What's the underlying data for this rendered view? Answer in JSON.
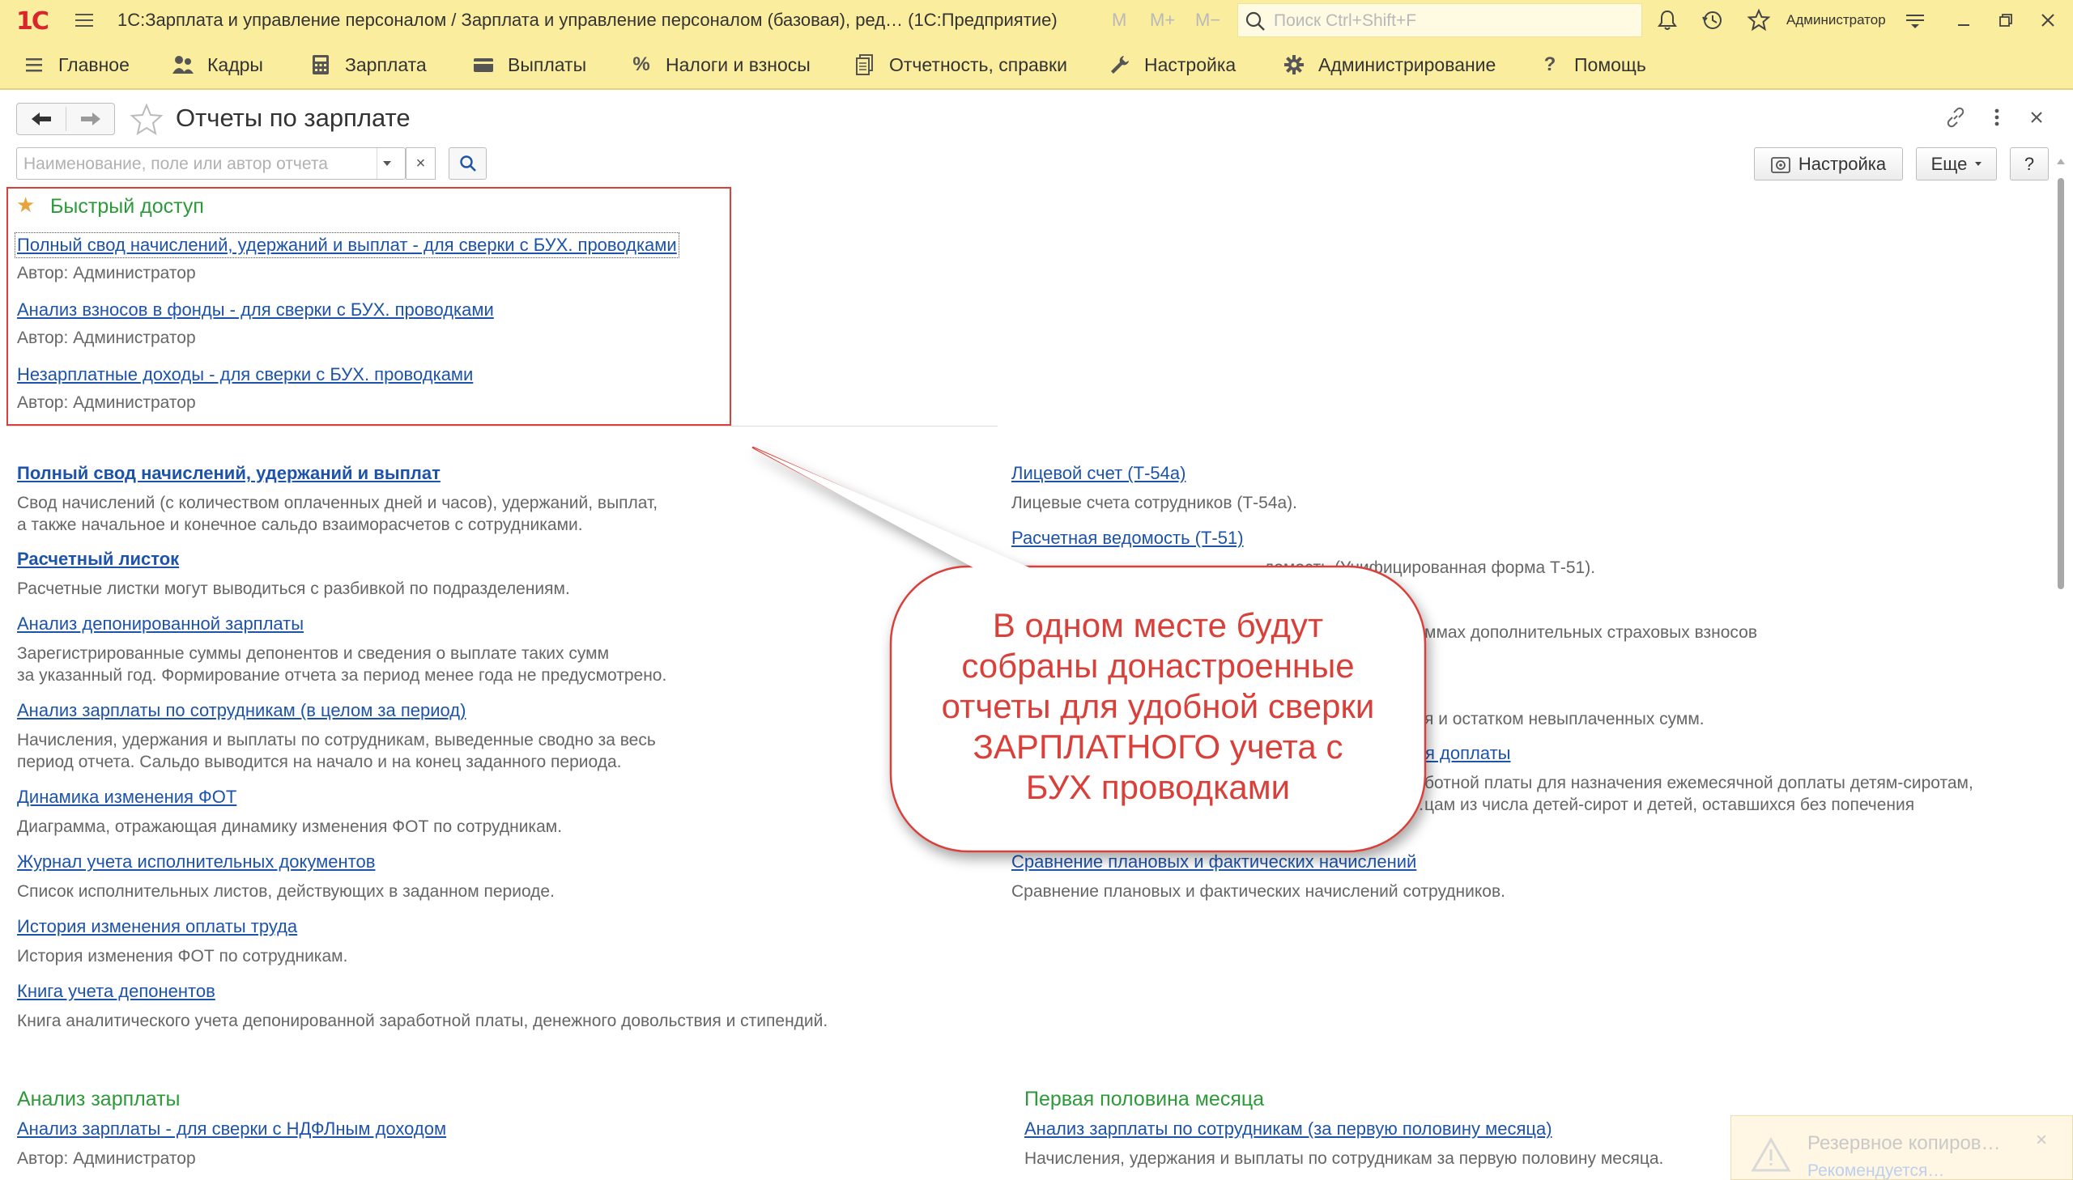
{
  "app": {
    "title": "1С:Зарплата и управление персоналом / Зарплата и управление персоналом (базовая), ред… (1С:Предприятие)",
    "logo_text": "1С",
    "memory_buttons": [
      "M",
      "M+",
      "M−"
    ],
    "search_placeholder": "Поиск Ctrl+Shift+F",
    "user": "Администратор",
    "icons": [
      "bell-icon",
      "history-icon",
      "star-icon",
      "settings-icon",
      "minimize-icon",
      "restore-icon",
      "close-icon"
    ]
  },
  "sections": [
    {
      "label": "Главное",
      "icon": "menu-icon"
    },
    {
      "label": "Кадры",
      "icon": "people-icon"
    },
    {
      "label": "Зарплата",
      "icon": "calculator-icon"
    },
    {
      "label": "Выплаты",
      "icon": "wallet-icon"
    },
    {
      "label": "Налоги и взносы",
      "icon": "percent-icon"
    },
    {
      "label": "Отчетность, справки",
      "icon": "document-icon"
    },
    {
      "label": "Настройка",
      "icon": "wrench-icon"
    },
    {
      "label": "Администрирование",
      "icon": "gear-icon"
    },
    {
      "label": "Помощь",
      "icon": "question-icon"
    }
  ],
  "form": {
    "title": "Отчеты по зарплате",
    "filter_placeholder": "Наименование, поле или автор отчета",
    "clear_label": "×",
    "settings_button": "Настройка",
    "more_button": "Еще",
    "help_button": "?"
  },
  "quick_access": {
    "title": "Быстрый доступ",
    "items": [
      {
        "link": "Полный свод начислений, удержаний и выплат - для сверки с БУХ. проводками",
        "author": "Автор: Администратор"
      },
      {
        "link": "Анализ взносов в фонды - для сверки с БУХ. проводками",
        "author": "Автор: Администратор"
      },
      {
        "link": "Незарплатные доходы - для сверки с БУХ. проводками",
        "author": "Автор: Администратор"
      }
    ]
  },
  "left_reports": [
    {
      "link": "Полный свод начислений, удержаний и выплат",
      "desc": [
        "Свод начислений (с количеством оплаченных дней и часов), удержаний, выплат,",
        "а также начальное и конечное сальдо взаиморасчетов с сотрудниками."
      ]
    },
    {
      "link": "Расчетный листок",
      "desc": [
        "Расчетные листки могут выводиться с разбивкой по подразделениям."
      ]
    },
    {
      "link": "Анализ депонированной зарплаты",
      "desc": [
        "Зарегистрированные суммы депонентов и сведения о выплате таких сумм",
        "за указанный год. Формирование отчета за период менее года не предусмотрено."
      ]
    },
    {
      "link": "Анализ зарплаты по сотрудникам (в целом за период)",
      "desc": [
        "Начисления, удержания и выплаты по сотрудникам, выведенные сводно за весь",
        "период отчета. Сальдо выводится на начало и на конец заданного периода."
      ]
    },
    {
      "link": "Динамика изменения ФОТ",
      "desc": [
        "Диаграмма, отражающая динамику изменения ФОТ по сотрудникам."
      ]
    },
    {
      "link": "Журнал учета исполнительных документов",
      "desc": [
        "Список исполнительных листов, действующих в заданном периоде."
      ]
    },
    {
      "link": "История изменения оплаты труда",
      "desc": [
        "История изменения ФОТ по сотрудникам."
      ]
    },
    {
      "link": "Книга учета депонентов",
      "desc": [
        "Книга аналитического учета депонированной заработной платы, денежного довольствия и стипендий."
      ]
    }
  ],
  "right_reports": {
    "r1": {
      "link": "Лицевой счет (Т-54а)",
      "desc": "Лицевые счета сотрудников (Т-54а)."
    },
    "r2": {
      "link": "Расчетная ведомость (Т-51)",
      "desc": "…домость (Унифицированная форма Т-51)."
    },
    "r3_desc": "…ммах дополнительных страховых взносов",
    "r4_desc": "…я и остатком невыплаченных сумм.",
    "r5": {
      "link": "…я доплаты",
      "desc": [
        "…ботной платы для назначения ежемесячной доплаты детям-сиротам,",
        "…цам из числа детей-сирот и детей, оставшихся без попечения"
      ]
    },
    "r6": {
      "link": "Сравнение плановых и фактических начислений",
      "desc": "Сравнение плановых и фактических начислений сотрудников."
    }
  },
  "groups": {
    "left": {
      "title": "Анализ зарплаты",
      "link": "Анализ зарплаты - для сверки с НДФЛным доходом",
      "author": "Автор: Администратор"
    },
    "right": {
      "title": "Первая половина месяца",
      "link": "Анализ зарплаты по сотрудникам (за первую половину месяца)",
      "desc": "Начисления, удержания и выплаты по сотрудникам за первую половину месяца."
    }
  },
  "callout": {
    "text": "В одном месте будут\nсобраны донастроенные\nотчеты для удобной сверки\nЗАРПЛАТНОГО учета с\nБУХ проводками",
    "color": "#d9403a"
  },
  "notification": {
    "title": "Резервное копиров…",
    "subtitle": "Рекомендуется…",
    "close": "×"
  },
  "colors": {
    "panel": "#fbed9e",
    "link": "#1d53a8",
    "group_title": "#2d9a3a",
    "accent_red": "#d9403a"
  }
}
